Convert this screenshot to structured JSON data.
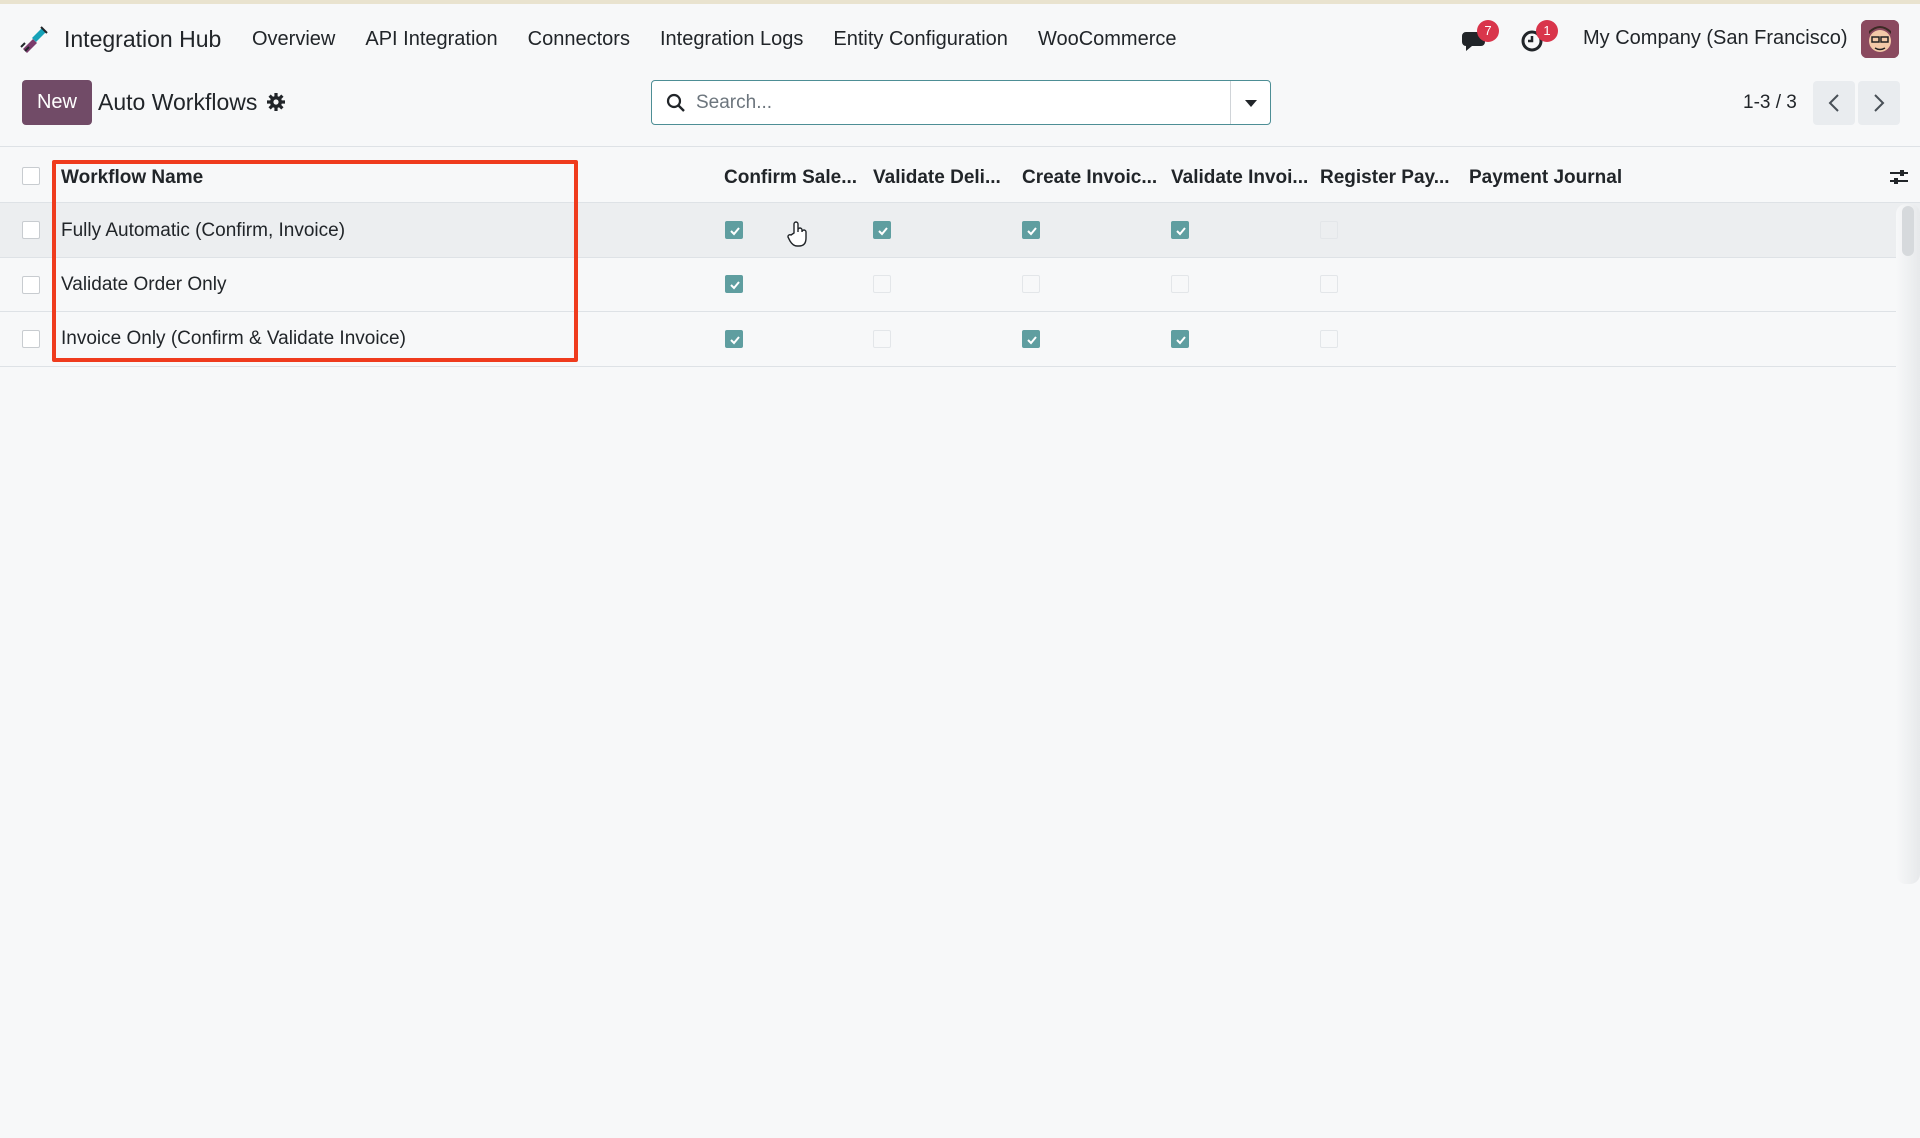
{
  "app": {
    "name": "Integration Hub",
    "menu": [
      "Overview",
      "API Integration",
      "Connectors",
      "Integration Logs",
      "Entity Configuration",
      "WooCommerce"
    ]
  },
  "systray": {
    "messages_count": "7",
    "activities_count": "1",
    "company": "My Company (San Francisco)"
  },
  "control_panel": {
    "new_label": "New",
    "title": "Auto Workflows",
    "search_placeholder": "Search...",
    "pager": "1-3 / 3"
  },
  "table": {
    "columns": [
      "Workflow Name",
      "Confirm Sale...",
      "Validate Deli...",
      "Create Invoic...",
      "Validate Invoi...",
      "Register Pay...",
      "Payment Journal"
    ],
    "rows": [
      {
        "name": "Fully Automatic (Confirm, Invoice)",
        "flags": [
          true,
          true,
          true,
          true,
          false
        ],
        "payment_journal": ""
      },
      {
        "name": "Validate Order Only",
        "flags": [
          true,
          false,
          false,
          false,
          false
        ],
        "payment_journal": ""
      },
      {
        "name": "Invoice Only (Confirm & Validate Invoice)",
        "flags": [
          true,
          false,
          true,
          true,
          false
        ],
        "payment_journal": ""
      }
    ]
  },
  "colors": {
    "brand": "#714b67",
    "checkbox_checked": "#5f9ea0",
    "highlight": "#ef3b1d",
    "badge": "#d9354b"
  },
  "icons": [
    "app-logo-icon",
    "chat-icon",
    "clock-icon",
    "gear-icon",
    "search-icon",
    "caret-down-icon",
    "chevron-left-icon",
    "chevron-right-icon",
    "column-settings-icon",
    "hand-cursor-icon"
  ]
}
